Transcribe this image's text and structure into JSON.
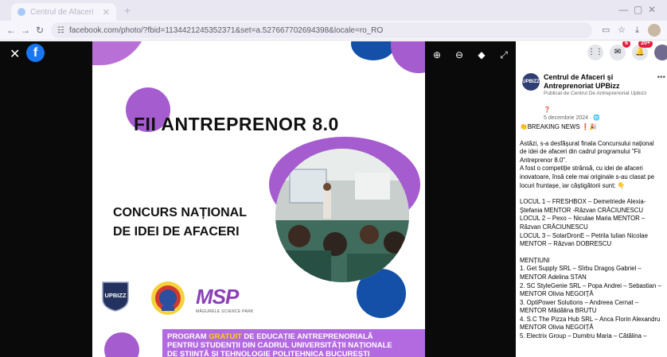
{
  "browser": {
    "tab_title": "Centrul de Afaceri",
    "url": "facebook.com/photo/?fbid=1134421245352371&set=a.527667702694398&locale=ro_RO"
  },
  "viewer": {
    "logo_letter": "f"
  },
  "poster": {
    "title": "FII ANTREPRENOR 8.0",
    "subtitle_line1": "CONCURS NAȚIONAL",
    "subtitle_line2": "DE IDEI DE AFACERI",
    "logo_upbizz": "UPBIZZ",
    "logo_msp": "MSP",
    "logo_msp_sub": "MĂGURELE SCIENCE PARK",
    "banner_line1_pre": "PROGRAM ",
    "banner_line1_hl": "GRATUIT",
    "banner_line1_post": " DE EDUCAȚIE ANTREPRENORIALĂ",
    "banner_line2": "PENTRU STUDENȚII DIN CADRUL UNIVERSITĂȚII NAȚIONALE",
    "banner_line3": "DE ȘTIINȚĂ ȘI TEHNOLOGIE POLITEHNICA BUCUREȘTI"
  },
  "notifications": {
    "messenger_badge": "6",
    "bell_badge": "20+"
  },
  "post": {
    "page_name": "Centrul de Afaceri și Antreprenoriat UPBizz",
    "published_by": "Publicat de Centrul De Antreprenoriat Upbizz",
    "date": "5 decembrie 2024",
    "avatar_text": "UPBIZZ",
    "lines": [
      "👏BREAKING NEWS ❗🎉",
      "",
      "Astăzi, s-a desfășurat finala Concursului național",
      "de idei de afaceri din cadrul programului \"Fii",
      "Antreprenor 8.0\".",
      "A fost o competiție strânsă, cu idei de afaceri",
      "inovatoare, însă cele mai originale s-au clasat pe",
      "locuri fruntașe, iar câștigătorii sunt: 👇",
      "",
      "LOCUL 1 – FRESHBOX – Demetriede Alexia-",
      "Ștefania MENTOR -Răzvan CRĂCIUNESCU",
      "LOCUL 2 – Pexo – Niculae Maria MENTOR –",
      "Răzvan CRĂCIUNESCU",
      "LOCUL 3 – SolarDronE – Petrila Iulian Nicolae",
      "MENTOR – Răzvan DOBRESCU",
      "",
      "MENȚIUNI",
      "1. Get Supply SRL – Sîrbu Dragoș Gabriel –",
      "MENTOR Adelina STAN",
      "2. SC StyleGenie SRL – Popa Andrei – Sebastian –",
      "MENTOR Olivia NEGOIȚĂ",
      "3. OptiPower Solutions – Andreea Cernat –",
      "MENTOR Mădălina BRUTU",
      "4. S.C The Pizza Hub SRL – Anca Florin Alexandru",
      "MENTOR Olivia NEGOIȚĂ",
      "5. Electrix Group – Dumitru Maria – Cătălina –"
    ]
  }
}
